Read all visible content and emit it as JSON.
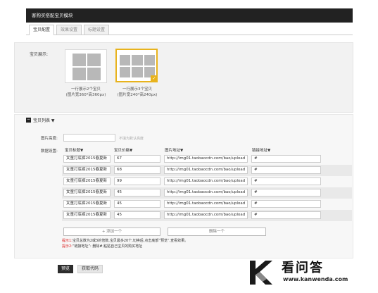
{
  "window": {
    "title": "客购买搭配宝贝模块"
  },
  "tabs": [
    {
      "label": "宝贝配置",
      "active": true
    },
    {
      "label": "效果设置",
      "active": false
    },
    {
      "label": "标题设置",
      "active": false
    }
  ],
  "display": {
    "label": "宝贝展示:",
    "options": [
      {
        "line1": "一行展示2个宝贝",
        "line2": "(图片宽360*高360px)",
        "selected": false
      },
      {
        "line1": "一行展示3个宝贝",
        "line2": "(图片宽240*高240px)",
        "selected": true
      }
    ]
  },
  "list": {
    "title": "宝贝列表 ▼",
    "image_height_label": "图片高度:",
    "image_height_value": "",
    "image_height_hint": "不填为默认高度",
    "data_settings_label": "数据设置:",
    "columns": [
      "宝贝标题▼",
      "宝贝价格▼",
      "图片地址▼",
      "链接地址▼"
    ],
    "rows": [
      {
        "title": "女童打底裤2015春夏新",
        "price": "67",
        "image": "http://img01.taobaocdn.com/bao/upload",
        "link": "#"
      },
      {
        "title": "女童打底裤2015春夏新",
        "price": "68",
        "image": "http://img01.taobaocdn.com/bao/upload",
        "link": "#"
      },
      {
        "title": "女童打底裤2015春夏新",
        "price": "99",
        "image": "http://img01.taobaocdn.com/bao/upload",
        "link": "#"
      },
      {
        "title": "女童打底裤2015春夏新",
        "price": "45",
        "image": "http://img01.taobaocdn.com/bao/upload",
        "link": "#"
      },
      {
        "title": "女童打底裤2015春夏新",
        "price": "45",
        "image": "http://img01.taobaocdn.com/bao/upload",
        "link": "#"
      },
      {
        "title": "女童打底裤2015春夏新",
        "price": "45",
        "image": "http://img01.taobaocdn.com/bao/upload",
        "link": "#"
      }
    ],
    "add_label": "+ 添加一个",
    "delete_label": "删除一个",
    "tip1_prefix": "提示1:",
    "tip1_text": "宝贝总数为2或3的倍数,宝贝最多20个,切换后,点击底部“预览”,查看效果。",
    "tip2_prefix": "提示2:",
    "tip2_text": "“链接地址”: 删除#,粘贴自己宝贝的购买地址"
  },
  "footer": {
    "preview_label": "预览",
    "get_code_label": "获取代码"
  },
  "watermark": {
    "title": "看问答",
    "url": "www.kanwenda.com"
  },
  "colors": {
    "titlebar": "#222222",
    "selected_border": "#e8b31d",
    "tip_red": "#dd2222"
  }
}
